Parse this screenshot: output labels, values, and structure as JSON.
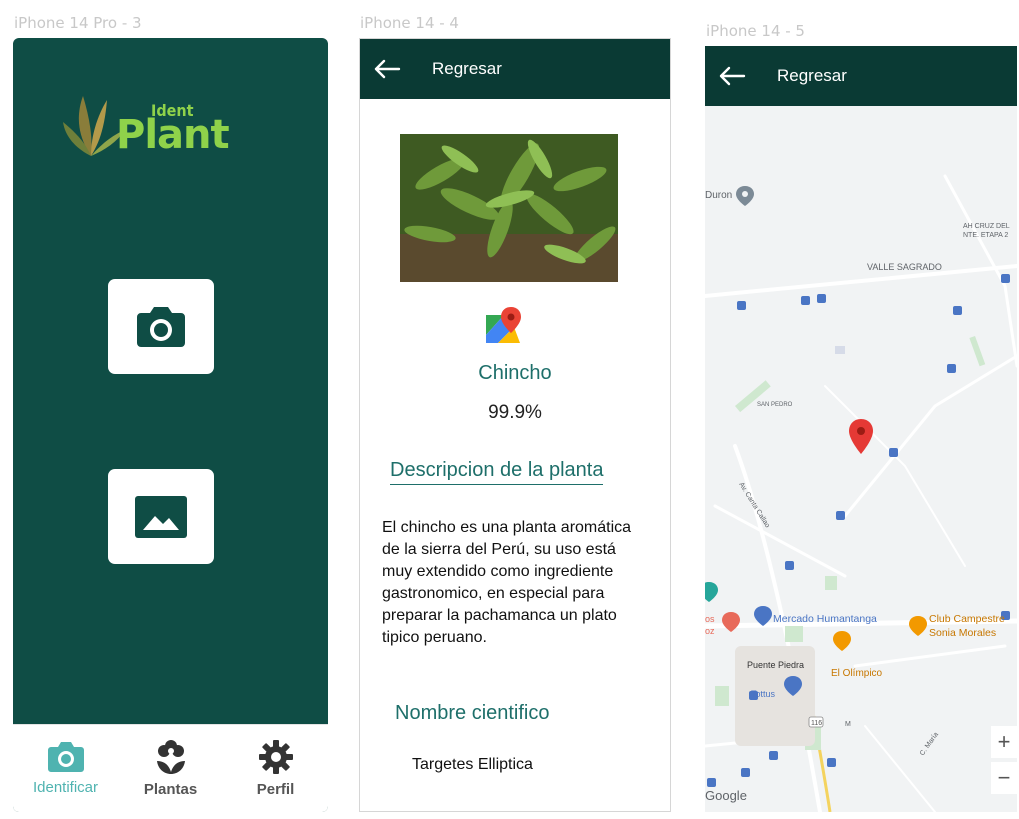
{
  "frames": {
    "s1_label": "iPhone 14 Pro - 3",
    "s2_label": "iPhone 14 - 4",
    "s3_label": "iPhone 14 - 5"
  },
  "home": {
    "logo_small": "Ident",
    "logo_big": "Plant",
    "camera_icon": "camera-icon",
    "gallery_icon": "image-icon",
    "nav": [
      {
        "label": "Identificar",
        "icon": "camera-icon"
      },
      {
        "label": "Plantas",
        "icon": "flower-icon"
      },
      {
        "label": "Perfil",
        "icon": "gear-icon"
      }
    ]
  },
  "detail": {
    "back_label": "Regresar",
    "plant_name": "Chincho",
    "confidence": "99.9%",
    "description_title": "Descripcion de la planta",
    "description": "El chincho es una planta aromática  de la sierra del Perú, su uso está muy extendido como ingrediente gastronomico, en especial para preparar la pachamanca un plato tipico peruano.",
    "scientific_title": "Nombre cientifico",
    "scientific_name": "Targetes Elliptica"
  },
  "map": {
    "back_label": "Regresar",
    "labels": {
      "duron": "Duron",
      "cruz": "AH CRUZ DEL",
      "etapa": "NTE. ETAPA 2",
      "valle": "VALLE SAGRADO",
      "sanpedro": "SAN PEDRO",
      "av": "Av. Canta Callao",
      "mercado": "Mercado Humantanga",
      "club1": "Club Campestre",
      "club2": "Sonia Morales",
      "puente": "Puente Piedra",
      "tottus": "Tottus",
      "olimpico": "El Olímpico",
      "route": "116",
      "google": "Google",
      "tos": "os",
      "oz": "oz",
      "m": "M",
      "cmaria": "C. María"
    },
    "zoom_in": "+",
    "zoom_out": "−"
  },
  "colors": {
    "brand_dark": "#0a3a34",
    "home_bg": "#0f4d45",
    "accent": "#1e6f6a",
    "logo": "#8fd24a",
    "active_nav": "#4fb3b0"
  }
}
